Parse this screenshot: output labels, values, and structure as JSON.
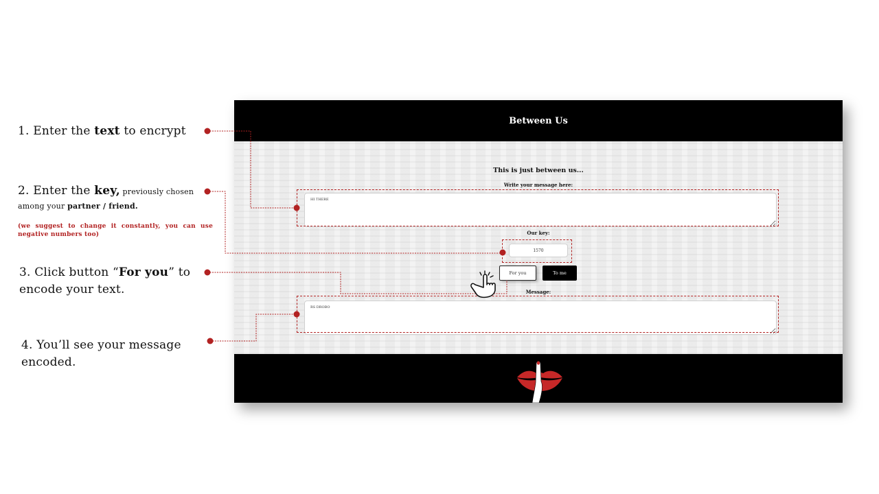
{
  "instructions": {
    "step1": {
      "prefix": "1. Enter the ",
      "bold": "text",
      "suffix": " to encrypt"
    },
    "step2": {
      "prefix": "2. Enter the ",
      "bold": "key",
      "comma": ",",
      "small": " previously chosen",
      "line2_prefix": "among your ",
      "line2_bold": "partner / friend.",
      "note": "(we suggest to change it constantly, you can use negative numbers too)"
    },
    "step3": {
      "prefix": "3. Click button “",
      "bold": "For you",
      "suffix": "” to encode your text."
    },
    "step4": {
      "text": "4. You’ll see your message encoded."
    }
  },
  "app": {
    "title": "Between Us",
    "tagline": "This is just between us...",
    "message_label": "Write your message here:",
    "message_value": "HI THERE",
    "key_label": "Our key:",
    "key_value": "1570",
    "for_you_label": "For you",
    "to_me_label": "To me",
    "output_label": "Message:",
    "output_value": "RS DROBO"
  },
  "colors": {
    "accent": "#b22222",
    "header_bg": "#000000",
    "footer_bg": "#000000"
  },
  "icons": {
    "hand": "pointing-hand-icon",
    "logo": "lips-finger-logo"
  }
}
